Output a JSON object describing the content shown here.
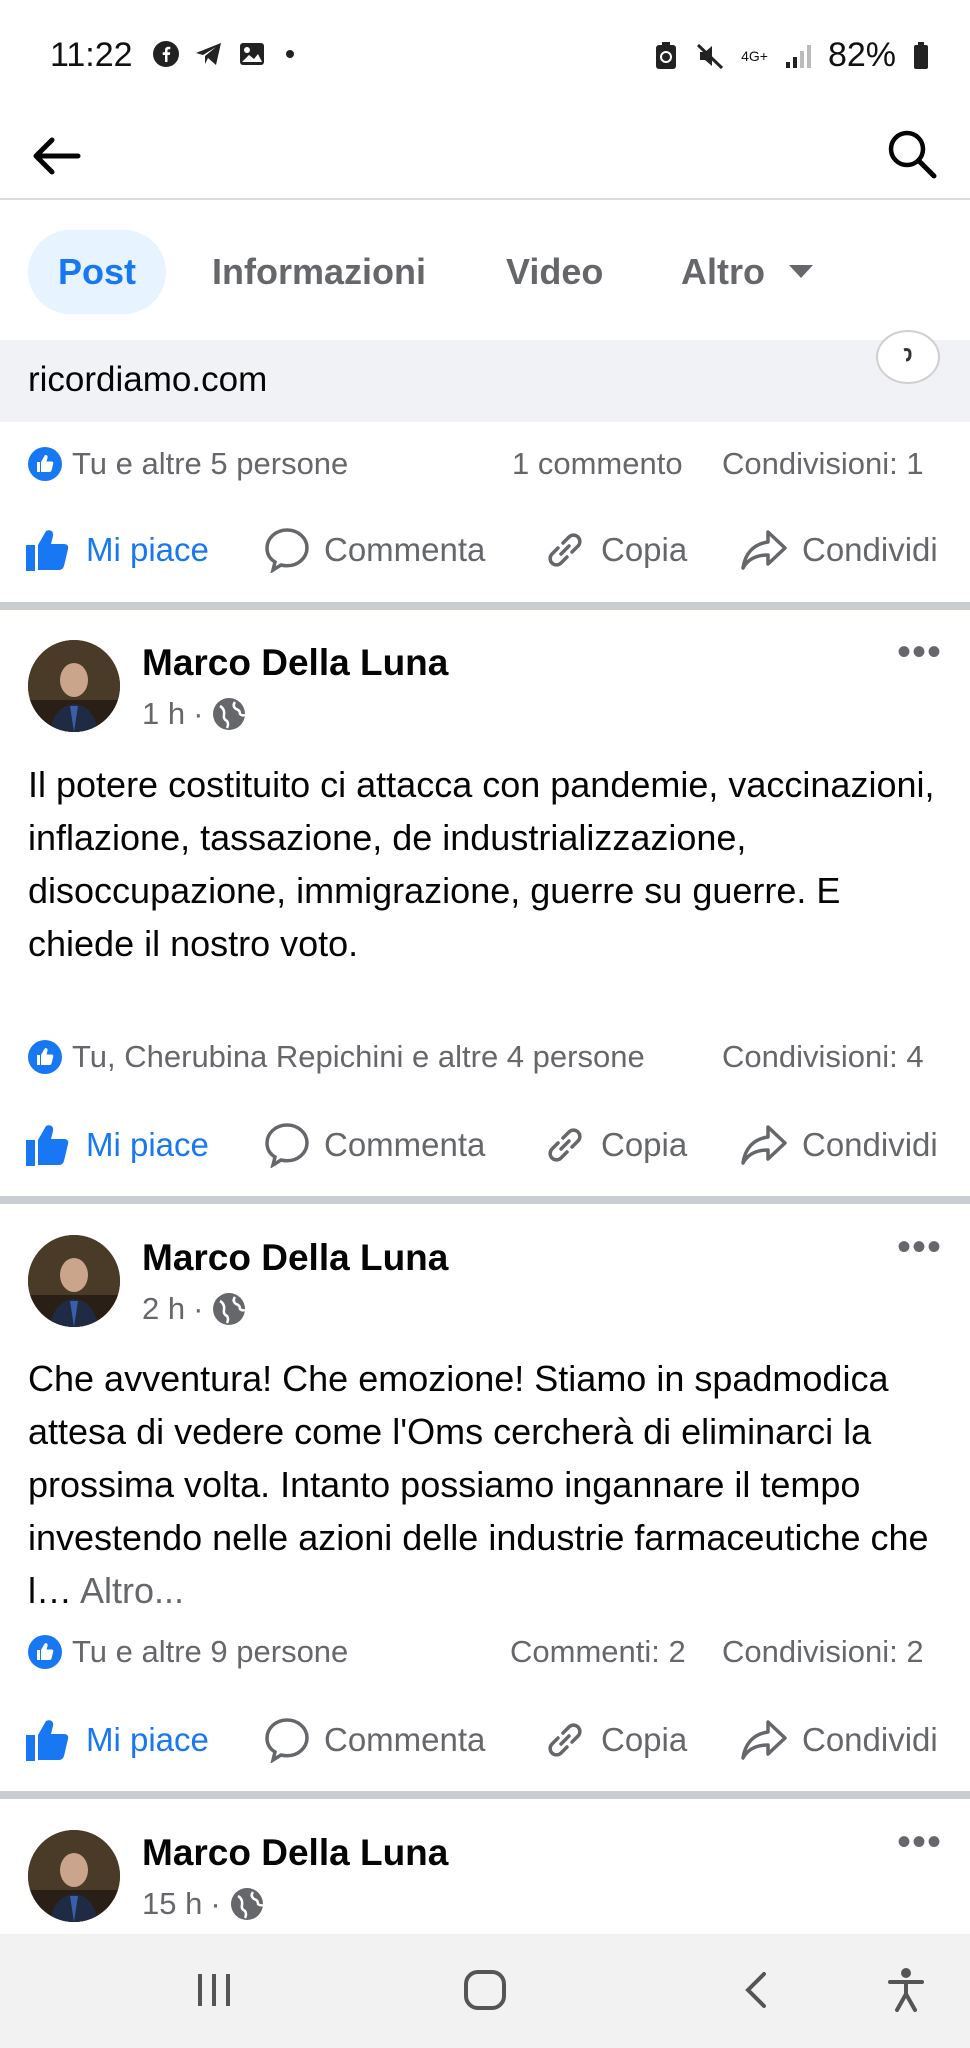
{
  "status_bar": {
    "time": "11:22",
    "battery": "82%",
    "network": "4G+"
  },
  "tabs": [
    {
      "label": "Post"
    },
    {
      "label": "Informazioni"
    },
    {
      "label": "Video"
    },
    {
      "label": "Altro"
    }
  ],
  "link_strip": {
    "text": "ricordiamo.com"
  },
  "first_post": {
    "reactions": "Tu e altre 5 persone",
    "comments": "1 commento",
    "shares": "Condivisioni: 1"
  },
  "actions": {
    "like": "Mi piace",
    "comment": "Commenta",
    "copy": "Copia",
    "share": "Condividi"
  },
  "posts": [
    {
      "author": "Marco Della Luna",
      "time": "1 h",
      "text": "Il potere costituito ci attacca con pandemie, vaccinazioni, inflazione, tassazione, de industrializzazione, disoccupazione, immigrazione, guerre su guerre. E chiede il nostro voto.",
      "reactions": "Tu, Cherubina Repichini e altre 4 persone",
      "comments": "",
      "shares": "Condivisioni: 4"
    },
    {
      "author": "Marco Della Luna",
      "time": "2 h",
      "text": "Che avventura! Che emozione! Stiamo in spadmodica attesa di vedere come l'Oms cercherà di eliminarci la prossima volta. Intanto possiamo ingannare il tempo investendo nelle azioni delle industrie farmaceutiche che l…",
      "more": "Altro...",
      "reactions": "Tu e altre 9 persone",
      "comments": "Commenti: 2",
      "shares": "Condivisioni: 2"
    },
    {
      "author": "Marco Della Luna",
      "time": "15 h"
    }
  ],
  "colors": {
    "accent": "#1877f2",
    "secondary_text": "#65676b",
    "divider": "#c9ccd1"
  }
}
